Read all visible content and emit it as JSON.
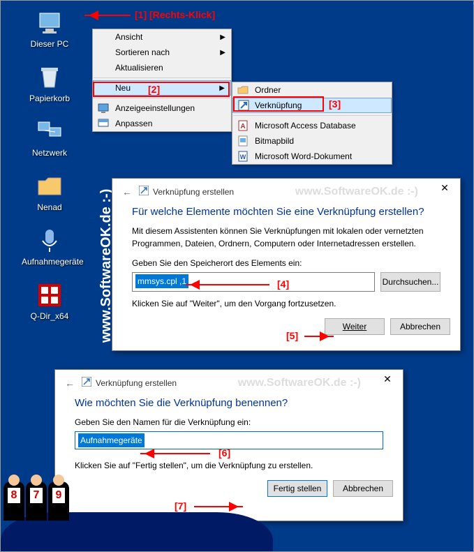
{
  "desktop": {
    "icons": [
      {
        "label": "Dieser PC"
      },
      {
        "label": "Papierkorb"
      },
      {
        "label": "Netzwerk"
      },
      {
        "label": "Nenad"
      },
      {
        "label": "Aufnahmegeräte"
      },
      {
        "label": "Q-Dir_x64"
      }
    ]
  },
  "watermark_left": "www.SoftwareOK.de  :-)",
  "context1": {
    "ansicht": "Ansicht",
    "sortieren": "Sortieren nach",
    "aktualisieren": "Aktualisieren",
    "neu": "Neu",
    "anzeige": "Anzeigeeinstellungen",
    "anpassen": "Anpassen"
  },
  "context2": {
    "ordner": "Ordner",
    "verknuepfung": "Verknüpfung",
    "access": "Microsoft Access Database",
    "bitmap": "Bitmapbild",
    "word": "Microsoft Word-Dokument"
  },
  "annotations": {
    "a1": "[1]  [Rechts-Klick]",
    "a2": "[2]",
    "a3": "[3]",
    "a4": "[4]",
    "a5": "[5]",
    "a6": "[6]",
    "a7": "[7]"
  },
  "dialog1": {
    "header": "Verknüpfung erstellen",
    "watermark": "www.SoftwareOK.de :-)",
    "title": "Für welche Elemente möchten Sie eine Verknüpfung erstellen?",
    "desc": "Mit diesem Assistenten können Sie Verknüpfungen mit lokalen oder vernetzten Programmen,  Dateien, Ordnern, Computern oder Internetadressen erstellen.",
    "label": "Geben Sie den Speicherort des Elements ein:",
    "value": "mmsys.cpl ,1",
    "browse": "Durchsuchen...",
    "hint": "Klicken Sie auf \"Weiter\", um den Vorgang fortzusetzen.",
    "next": "Weiter",
    "cancel": "Abbrechen"
  },
  "dialog2": {
    "header": "Verknüpfung erstellen",
    "watermark": "www.SoftwareOK.de :-)",
    "title": "Wie möchten Sie die Verknüpfung benennen?",
    "label": "Geben Sie den Namen für die Verknüpfung ein:",
    "value": "Aufnahmegeräte",
    "hint": "Klicken Sie auf \"Fertig stellen\", um die Verknüpfung zu erstellen.",
    "finish": "Fertig stellen",
    "cancel": "Abbrechen"
  },
  "judges": [
    "8",
    "7",
    "9"
  ]
}
